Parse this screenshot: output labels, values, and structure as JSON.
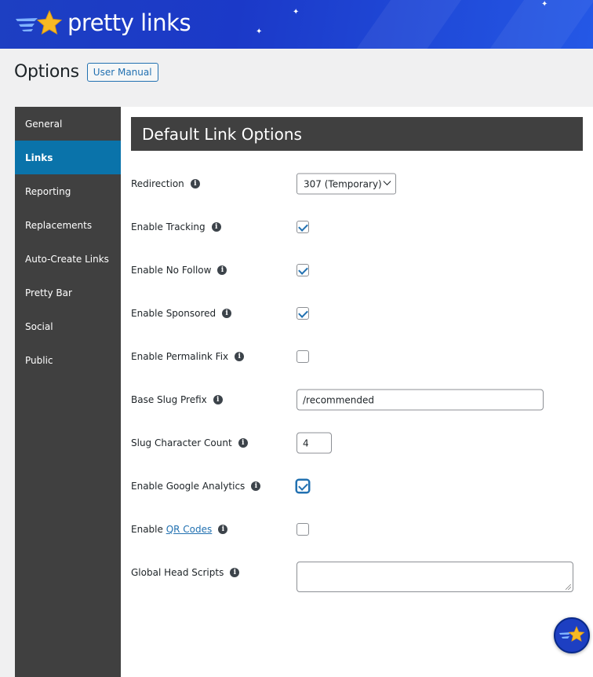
{
  "app": {
    "brand_name": "pretty links"
  },
  "header": {
    "page_title": "Options",
    "manual_button": "User Manual"
  },
  "sidebar": {
    "items": [
      {
        "label": "General",
        "active": false
      },
      {
        "label": "Links",
        "active": true
      },
      {
        "label": "Reporting",
        "active": false
      },
      {
        "label": "Replacements",
        "active": false
      },
      {
        "label": "Auto-Create Links",
        "active": false
      },
      {
        "label": "Pretty Bar",
        "active": false
      },
      {
        "label": "Social",
        "active": false
      },
      {
        "label": "Public",
        "active": false
      }
    ]
  },
  "section": {
    "title": "Default Link Options"
  },
  "fields": {
    "redirection": {
      "label": "Redirection",
      "value": "307 (Temporary)"
    },
    "tracking": {
      "label": "Enable Tracking",
      "checked": true
    },
    "no_follow": {
      "label": "Enable No Follow",
      "checked": true
    },
    "sponsored": {
      "label": "Enable Sponsored",
      "checked": true
    },
    "permalink_fix": {
      "label": "Enable Permalink Fix",
      "checked": false
    },
    "base_slug": {
      "label": "Base Slug Prefix",
      "value": "/recommended"
    },
    "slug_count": {
      "label": "Slug Character Count",
      "value": "4"
    },
    "google_analytics": {
      "label": "Enable Google Analytics",
      "checked": true
    },
    "qr_codes": {
      "label_prefix": "Enable ",
      "link_text": "QR Codes",
      "checked": false
    },
    "head_scripts": {
      "label": "Global Head Scripts",
      "value": ""
    }
  },
  "icons": {
    "info": "info-icon",
    "star": "star-icon"
  },
  "colors": {
    "banner": "#1d3fc2",
    "sidebar": "#404040",
    "active": "#0a73aa",
    "accent": "#2271b1",
    "star": "#f7b924"
  }
}
